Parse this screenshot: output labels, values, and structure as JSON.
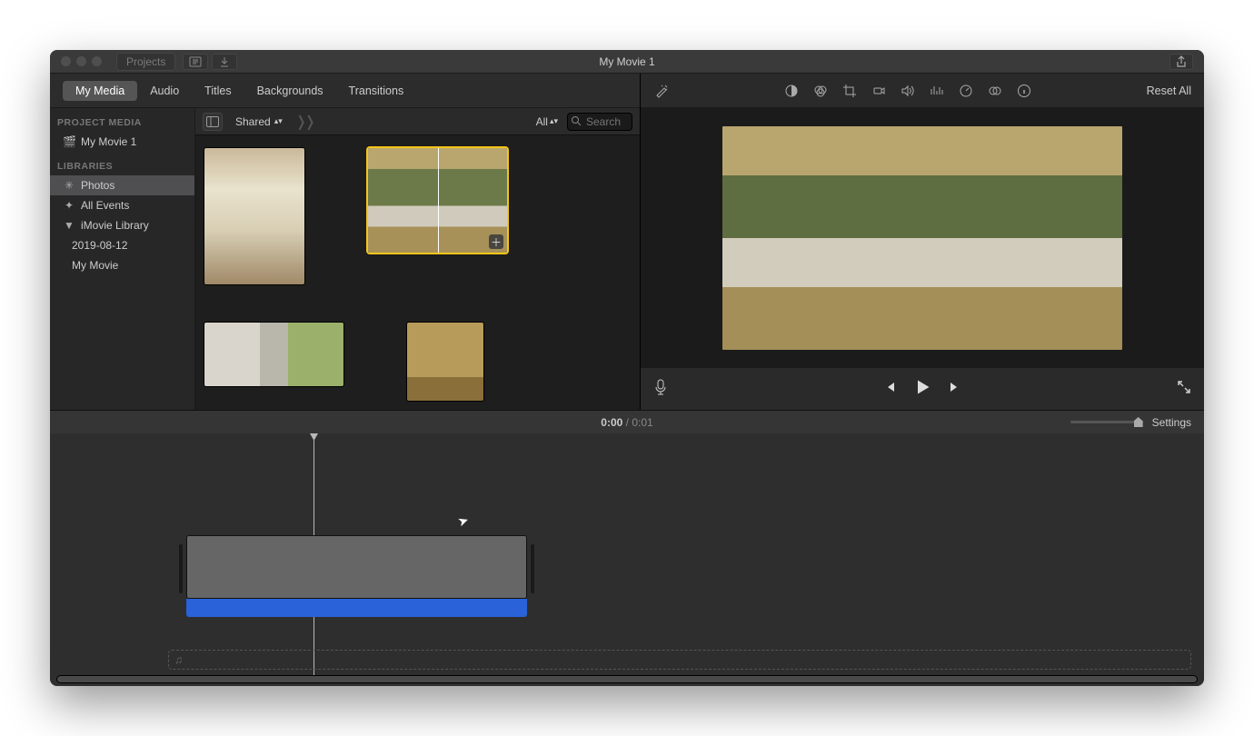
{
  "window": {
    "title": "My Movie 1"
  },
  "titlebar": {
    "projects_label": "Projects"
  },
  "tabs": {
    "my_media": "My Media",
    "audio": "Audio",
    "titles": "Titles",
    "backgrounds": "Backgrounds",
    "transitions": "Transitions",
    "active": "My Media"
  },
  "sidebar": {
    "section_project": "PROJECT MEDIA",
    "project_name": "My Movie 1",
    "section_libraries": "LIBRARIES",
    "photos": "Photos",
    "all_events": "All Events",
    "imovie_library": "iMovie Library",
    "event_date": "2019-08-12",
    "event_movie": "My Movie"
  },
  "media_toolbar": {
    "source": "Shared",
    "filter": "All",
    "search_placeholder": "Search"
  },
  "thumbnails": [
    {
      "id": "room",
      "w": 110,
      "h": 150,
      "selected": false,
      "cls": "img-room"
    },
    {
      "id": "garden",
      "w": 153,
      "h": 115,
      "selected": true,
      "cls": "img-garden"
    },
    {
      "id": "bldg",
      "w": 153,
      "h": 70,
      "selected": false,
      "cls": "img-bldg"
    },
    {
      "id": "window",
      "w": 84,
      "h": 86,
      "selected": false,
      "cls": "img-window"
    }
  ],
  "viewer": {
    "reset_label": "Reset All"
  },
  "timecode": {
    "current": "0:00",
    "total": "0:01"
  },
  "timeline_header": {
    "settings_label": "Settings"
  }
}
